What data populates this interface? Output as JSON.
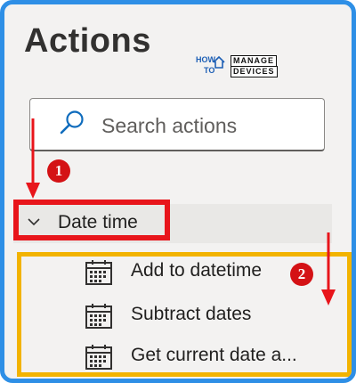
{
  "panel": {
    "title": "Actions",
    "search": {
      "placeholder": "Search actions",
      "value": ""
    },
    "category": {
      "label": "Date time",
      "expanded": true
    },
    "actions": [
      {
        "label": "Add to datetime",
        "icon": "calendar-icon"
      },
      {
        "label": "Subtract dates",
        "icon": "calendar-icon"
      },
      {
        "label": "Get current date a...",
        "icon": "calendar-icon"
      }
    ]
  },
  "watermark": {
    "how": "HOW",
    "to": "TO",
    "manage": "MANAGE",
    "devices": "DEVICES"
  },
  "annotations": {
    "step1": "1",
    "step2": "2",
    "colors": {
      "highlight_red": "#e8151b",
      "highlight_yellow": "#f2b300",
      "frame_blue": "#2e8fe6",
      "accent_blue": "#0f6cbd"
    }
  }
}
